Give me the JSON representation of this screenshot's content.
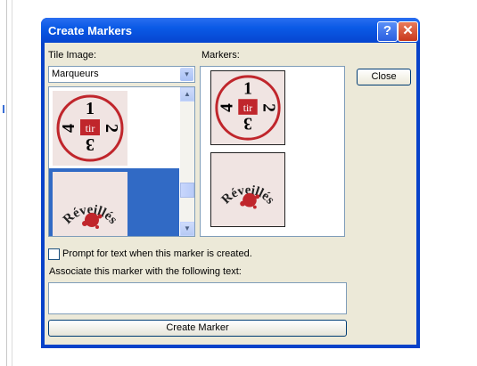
{
  "window": {
    "title": "Create Markers",
    "help_glyph": "?",
    "close_glyph": "✕"
  },
  "tile_image": {
    "label": "Tile Image:",
    "selected": "Marqueurs"
  },
  "markers": {
    "label": "Markers:"
  },
  "tiles": [
    {
      "name": "tir",
      "digits": [
        "1",
        "2",
        "3",
        "4"
      ],
      "center": "tir"
    },
    {
      "name": "reveilles",
      "text": "Réveillés"
    }
  ],
  "buttons": {
    "close": "Close",
    "create_marker": "Create Marker"
  },
  "prompt_checkbox": {
    "label": "Prompt for text when this marker is created.",
    "checked": false
  },
  "associate": {
    "label": "Associate this marker with the following text:",
    "value": ""
  },
  "icons": {
    "dropdown": "▾",
    "scroll_up": "▲",
    "scroll_down": "▼"
  },
  "colors": {
    "title_bar": "#0a5ae6",
    "selection": "#316ac5",
    "tile_red": "#c0262c"
  }
}
